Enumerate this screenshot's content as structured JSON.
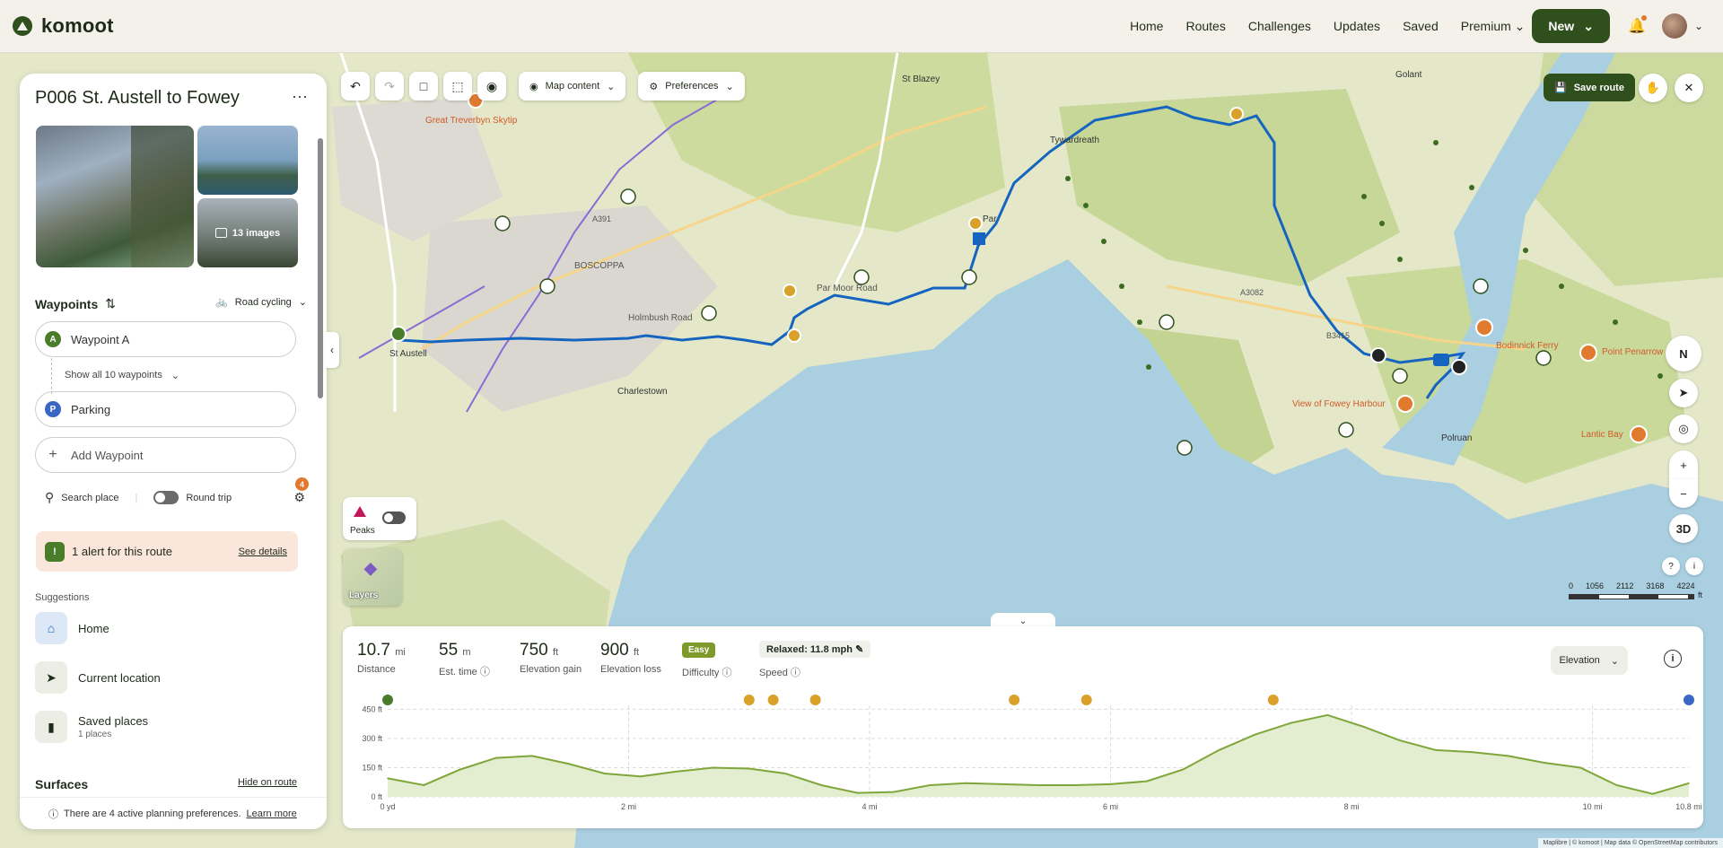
{
  "nav": {
    "brand": "komoot",
    "links": [
      "Home",
      "Routes",
      "Challenges",
      "Updates",
      "Saved",
      "Premium"
    ],
    "new_label": "New"
  },
  "route": {
    "title": "P006 St. Austell to Fowey",
    "images_label": "13 images"
  },
  "waypoints": {
    "heading": "Waypoints",
    "sport": "Road cycling",
    "first": "Waypoint A",
    "show_all": "Show all 10 waypoints",
    "last": "Parking",
    "add": "Add Waypoint"
  },
  "tools": {
    "search": "Search place",
    "round_trip": "Round trip",
    "filter_count": "4"
  },
  "alert": {
    "text": "1 alert for this route",
    "link": "See details"
  },
  "suggestions": {
    "heading": "Suggestions",
    "items": [
      {
        "label": "Home",
        "sub": ""
      },
      {
        "label": "Current location",
        "sub": ""
      },
      {
        "label": "Saved places",
        "sub": "1 places"
      }
    ]
  },
  "surfaces": {
    "heading": "Surfaces",
    "hide": "Hide on route"
  },
  "prefs_note": {
    "text": "There are 4 active planning preferences.",
    "link": "Learn more"
  },
  "maptools": {
    "map_content": "Map content",
    "preferences": "Preferences",
    "save_route": "Save route",
    "three_d": "3D",
    "compass": "N",
    "zoom_in": "+",
    "zoom_out": "−"
  },
  "overlays": {
    "peaks": "Peaks",
    "layers": "Layers"
  },
  "scale": {
    "ticks": [
      "0",
      "1056",
      "2112",
      "3168",
      "4224"
    ],
    "unit": "ft"
  },
  "map_labels": {
    "st_blazey": "St Blazey",
    "par_moor_road": "Par Moor Road",
    "charlestown": "Charlestown",
    "st_austell": "St Austell",
    "boscoppa": "BOSCOPPA",
    "polruan": "Polruan",
    "tywardreath": "Tywardreath",
    "a3082": "A3082",
    "a391": "A391",
    "b3415": "B3415",
    "golant": "Golant",
    "bodinnick": "Bodinnick Ferry",
    "view_fowey": "View of Fowey Harbour",
    "point_penarrow": "Point Penarrow",
    "lantic_bay": "Lantic Bay",
    "great_treverbyn": "Great Treverbyn Skytip",
    "holmbush_road": "Holmbush Road",
    "par": "Par"
  },
  "stats": {
    "distance": {
      "value": "10.7",
      "unit": "mi",
      "label": "Distance"
    },
    "time": {
      "value": "55",
      "unit": "m",
      "label": "Est. time"
    },
    "gain": {
      "value": "750",
      "unit": "ft",
      "label": "Elevation gain"
    },
    "loss": {
      "value": "900",
      "unit": "ft",
      "label": "Elevation loss"
    },
    "difficulty": {
      "value": "Easy",
      "label": "Difficulty"
    },
    "speed": {
      "value": "Relaxed: 11.8 mph",
      "label": "Speed"
    }
  },
  "elevation_select": "Elevation",
  "chart_data": {
    "type": "area",
    "title": "",
    "xlabel": "",
    "ylabel": "",
    "x_ticks": [
      "0 yd",
      "2 mi",
      "4 mi",
      "6 mi",
      "8 mi",
      "10 mi",
      "10.8 mi"
    ],
    "y_ticks": [
      "0 ft",
      "150 ft",
      "300 ft",
      "450 ft"
    ],
    "ylim": [
      0,
      470
    ],
    "xlim": [
      0,
      10.8
    ],
    "series": [
      {
        "x": [
          0,
          0.3,
          0.6,
          0.9,
          1.2,
          1.5,
          1.8,
          2.1,
          2.4,
          2.7,
          3.0,
          3.3,
          3.6,
          3.9,
          4.2,
          4.5,
          4.8,
          5.1,
          5.4,
          5.7,
          6.0,
          6.3,
          6.6,
          6.9,
          7.2,
          7.5,
          7.8,
          8.1,
          8.4,
          8.7,
          9.0,
          9.3,
          9.6,
          9.9,
          10.2,
          10.5,
          10.8
        ],
        "values": [
          95,
          60,
          140,
          200,
          210,
          170,
          120,
          105,
          130,
          150,
          145,
          120,
          60,
          20,
          25,
          60,
          70,
          65,
          60,
          60,
          65,
          80,
          140,
          240,
          320,
          380,
          420,
          360,
          290,
          240,
          230,
          210,
          175,
          150,
          60,
          15,
          70
        ]
      }
    ]
  },
  "attribution": "Maplibre | © komoot | Map data © OpenStreetMap contributors"
}
